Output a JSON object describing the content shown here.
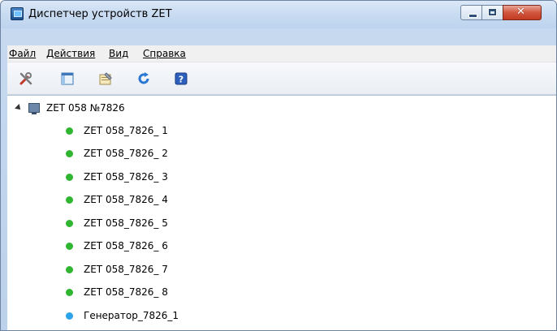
{
  "window": {
    "title": "Диспетчер устройств ZET",
    "minimize_label": "",
    "maximize_label": "",
    "close_label": "✕"
  },
  "menu": [
    {
      "label": "Файл"
    },
    {
      "label": "Действия"
    },
    {
      "label": "Вид"
    },
    {
      "label": "Справка"
    }
  ],
  "toolbar": [
    {
      "icon": "tools-icon"
    },
    {
      "icon": "device-list-icon"
    },
    {
      "icon": "properties-icon"
    },
    {
      "icon": "refresh-icon"
    },
    {
      "icon": "help-icon"
    }
  ],
  "tree": {
    "root": {
      "label": "ZET 058 №7826",
      "expanded": true,
      "icon": "computer-icon"
    },
    "children": [
      {
        "label": "ZET 058_7826_ 1",
        "status_color": "#2fb52f"
      },
      {
        "label": "ZET 058_7826_ 2",
        "status_color": "#2fb52f"
      },
      {
        "label": "ZET 058_7826_ 3",
        "status_color": "#2fb52f"
      },
      {
        "label": "ZET 058_7826_ 4",
        "status_color": "#2fb52f"
      },
      {
        "label": "ZET 058_7826_ 5",
        "status_color": "#2fb52f"
      },
      {
        "label": "ZET 058_7826_ 6",
        "status_color": "#2fb52f"
      },
      {
        "label": "ZET 058_7826_ 7",
        "status_color": "#2fb52f"
      },
      {
        "label": "ZET 058_7826_ 8",
        "status_color": "#2fb52f"
      },
      {
        "label": "Генератор_7826_1",
        "status_color": "#2aa3e8"
      }
    ]
  }
}
